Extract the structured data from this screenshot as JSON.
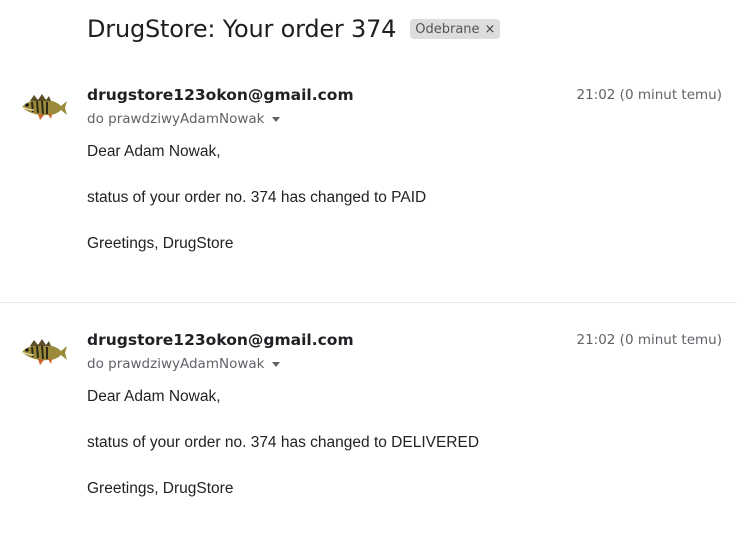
{
  "subject": {
    "title": "DrugStore: Your order 374",
    "label": "Odebrane",
    "label_remove": "×"
  },
  "messages": [
    {
      "sender": "drugstore123okon@gmail.com",
      "recipient": "do prawdziwyAdamNowak",
      "time": "21:02 (0 minut temu)",
      "greeting": "Dear Adam Nowak,",
      "body": "status of your order no. 374 has changed to PAID",
      "signoff": "Greetings, DrugStore"
    },
    {
      "sender": "drugstore123okon@gmail.com",
      "recipient": "do prawdziwyAdamNowak",
      "time": "21:02 (0 minut temu)",
      "greeting": "Dear Adam Nowak,",
      "body": "status of your order no. 374 has changed to DELIVERED",
      "signoff": "Greetings, DrugStore"
    }
  ],
  "icons": {
    "avatar": "perch-fish-icon",
    "recipient_menu": "chevron-down-icon",
    "label_remove": "close-icon"
  }
}
